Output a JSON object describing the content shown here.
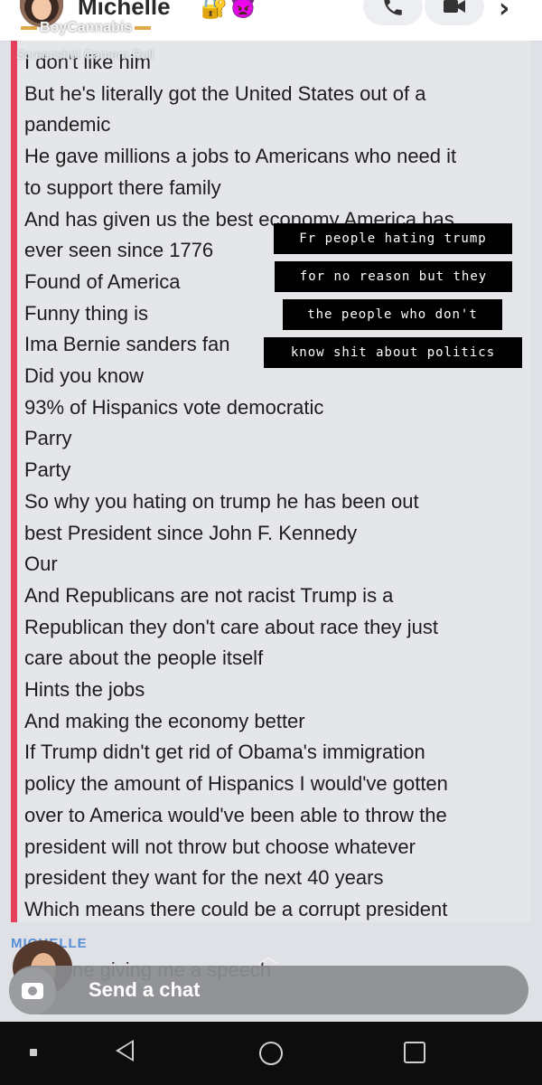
{
  "header": {
    "contact_name": "Michelle",
    "lock_emoji": "🔐",
    "devil_emoji": "👿",
    "call_icon": "phone-icon",
    "video_icon": "video-icon",
    "more_icon": "chevron-right-icon"
  },
  "overlay": {
    "ghost_label": "BoyCannabis",
    "ghost_subtext": "Screenshot Camera Roll"
  },
  "message": {
    "accent_color": "#e5405b",
    "lines": [
      "I don't like him",
      "But he's literally got the United States out of a",
      "pandemic",
      "He gave millions a jobs to Americans who need it",
      "to support there family",
      "And has given us the best economy America has",
      "ever seen since 1776",
      "Found of America",
      "Funny thing is",
      "Ima Bernie sanders fan",
      "Did you know",
      "93% of Hispanics vote democratic",
      "Parry",
      "Party",
      "So why you hating on trump he has been out",
      "best President since John F. Kennedy",
      "Our",
      "And Republicans are not racist Trump is a",
      "Republican they don't care about race they just",
      "care about the people itself",
      "Hints the jobs",
      "And making the economy better",
      "If Trump didn't get rid of Obama's immigration",
      "policy the amount of Hispanics I would've gotten",
      "over to America would've been able to throw the",
      "president will not throw but choose whatever",
      "president they want for the next 40 years",
      "Which means there could be a corrupt president"
    ]
  },
  "captions": [
    "Fr people hating trump",
    "for no reason but they",
    "the people who don't",
    "know shit about politics"
  ],
  "second_message": {
    "sender": "MICHELLE",
    "preview": "ne giving me a speech"
  },
  "input": {
    "placeholder": "Send a chat",
    "camera_icon": "camera-icon"
  },
  "navbar": {
    "back_icon": "back-triangle-icon",
    "home_icon": "home-circle-icon",
    "recents_icon": "recents-square-icon"
  }
}
